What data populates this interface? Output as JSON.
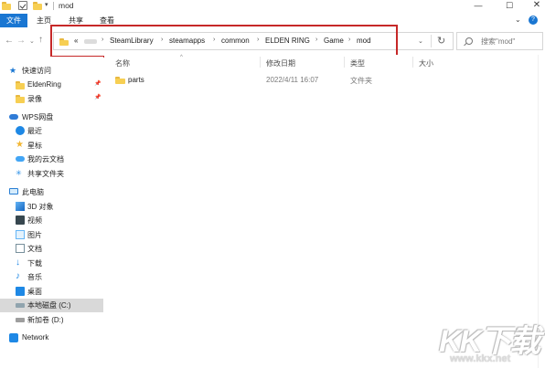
{
  "window": {
    "title": "mod",
    "qa_dropdown": "▾",
    "minimize": "—",
    "maximize": "☐",
    "close": "✕"
  },
  "ribbon": {
    "tabs": [
      "文件",
      "主页",
      "共享",
      "查看"
    ],
    "collapse": "⌄",
    "help": "?"
  },
  "nav": {
    "back": "←",
    "forward": "→",
    "recent": "⌄",
    "up": "↑"
  },
  "address": {
    "overflow": "«",
    "crumbs": [
      "SteamLibrary",
      "steamapps",
      "common",
      "ELDEN RING",
      "Game",
      "mod"
    ],
    "separator": "›",
    "dropdown": "⌄",
    "refresh": "↻"
  },
  "search": {
    "placeholder": "搜索\"mod\""
  },
  "sidebar": {
    "quick_access": "快速访问",
    "quick_items": [
      "EldenRing",
      "录像"
    ],
    "pin": "📌",
    "wps": "WPS网盘",
    "wps_items": [
      "最近",
      "星标",
      "我的云文档",
      "共享文件夹"
    ],
    "this_pc": "此电脑",
    "pc_items": [
      "3D 对象",
      "视频",
      "图片",
      "文档",
      "下载",
      "音乐",
      "桌面",
      "本地磁盘 (C:)",
      "新加卷 (D:)"
    ],
    "network": "Network"
  },
  "columns": {
    "name": "名称",
    "date": "修改日期",
    "type": "类型",
    "size": "大小",
    "sort_indicator": "^"
  },
  "files": [
    {
      "name": "parts",
      "date": "2022/4/11 16:07",
      "type": "文件夹"
    }
  ],
  "watermark": {
    "logo": "KK下载",
    "url": "www.kkx.net"
  },
  "colors": {
    "accent": "#1976d2",
    "highlight_box": "#c62828",
    "folder": "#f7cf53"
  }
}
